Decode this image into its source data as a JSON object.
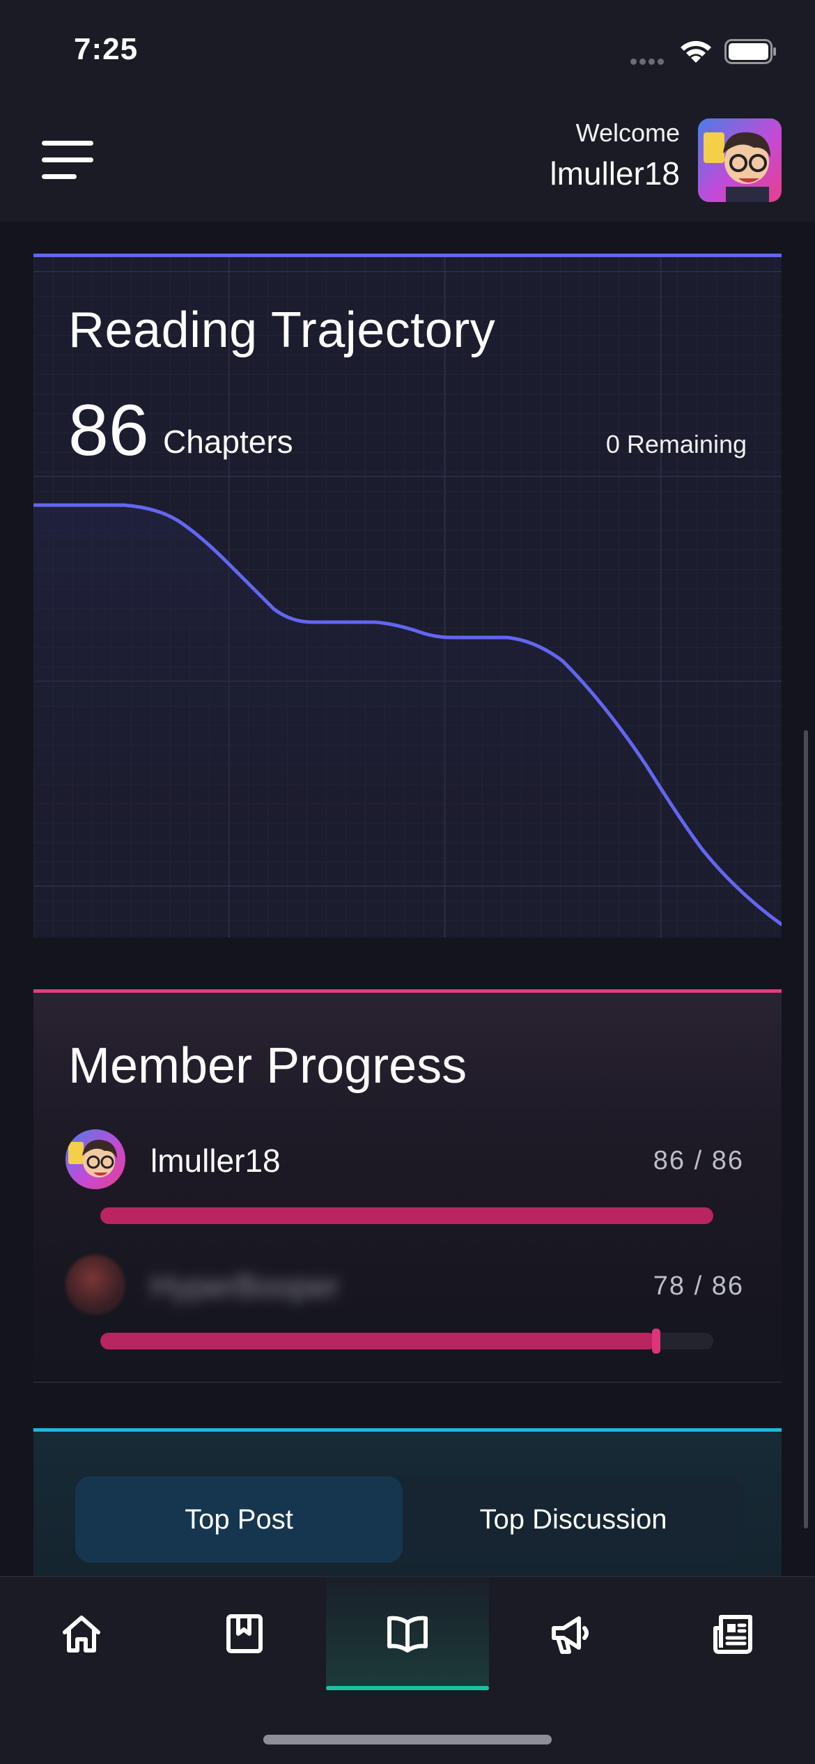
{
  "status_bar": {
    "time": "7:25"
  },
  "header": {
    "welcome_label": "Welcome",
    "username": "lmuller18"
  },
  "reading_trajectory": {
    "title": "Reading Trajectory",
    "count": "86",
    "count_unit": "Chapters",
    "remaining": "0 Remaining",
    "line_color": "#6366f1"
  },
  "member_progress": {
    "title": "Member Progress",
    "members": [
      {
        "name": "lmuller18",
        "score": "86 / 86",
        "progress": 1.0,
        "blurred": false
      },
      {
        "name": "HyperBooper",
        "score": "78 / 86",
        "progress": 0.907,
        "blurred": true
      }
    ],
    "bar_color": "#b8255f"
  },
  "top_section": {
    "tabs": [
      {
        "label": "Top Post",
        "active": true
      },
      {
        "label": "Top Discussion",
        "active": false
      }
    ]
  },
  "bottom_nav": {
    "items": [
      {
        "icon": "home-icon",
        "active": false
      },
      {
        "icon": "bookmark-book-icon",
        "active": false
      },
      {
        "icon": "open-book-icon",
        "active": true
      },
      {
        "icon": "megaphone-icon",
        "active": false
      },
      {
        "icon": "newspaper-icon",
        "active": false
      }
    ],
    "active_color": "#19c2a3"
  }
}
